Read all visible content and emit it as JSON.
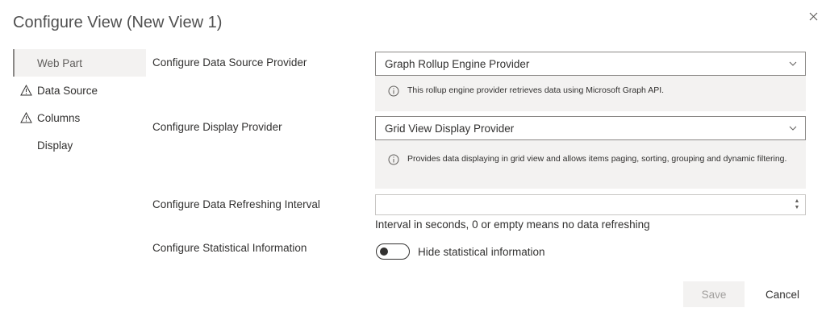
{
  "dialog": {
    "title": "Configure View (New View 1)",
    "close_icon": "close-icon"
  },
  "nav": {
    "items": [
      {
        "label": "Web Part",
        "icon": "",
        "selected": true
      },
      {
        "label": "Data Source",
        "icon": "warning-icon",
        "selected": false
      },
      {
        "label": "Columns",
        "icon": "warning-icon",
        "selected": false
      },
      {
        "label": "Display",
        "icon": "",
        "selected": false
      }
    ]
  },
  "form": {
    "data_source_provider": {
      "label": "Configure Data Source Provider",
      "value": "Graph Rollup Engine Provider",
      "info": "This rollup engine provider retrieves data using Microsoft Graph API."
    },
    "display_provider": {
      "label": "Configure Display Provider",
      "value": "Grid View Display Provider",
      "info": "Provides data displaying in grid view and allows items paging, sorting, grouping and dynamic filtering."
    },
    "refresh_interval": {
      "label": "Configure Data Refreshing Interval",
      "value": "",
      "hint": "Interval in seconds, 0 or empty means no data refreshing"
    },
    "statistics": {
      "label": "Configure Statistical Information",
      "toggle_on": false,
      "toggle_label": "Hide statistical information"
    }
  },
  "footer": {
    "save_label": "Save",
    "save_disabled": true,
    "cancel_label": "Cancel"
  },
  "colors": {
    "info_background": "#f3f2f1",
    "border": "#8a8886",
    "disabled_text": "#a19f9d"
  }
}
